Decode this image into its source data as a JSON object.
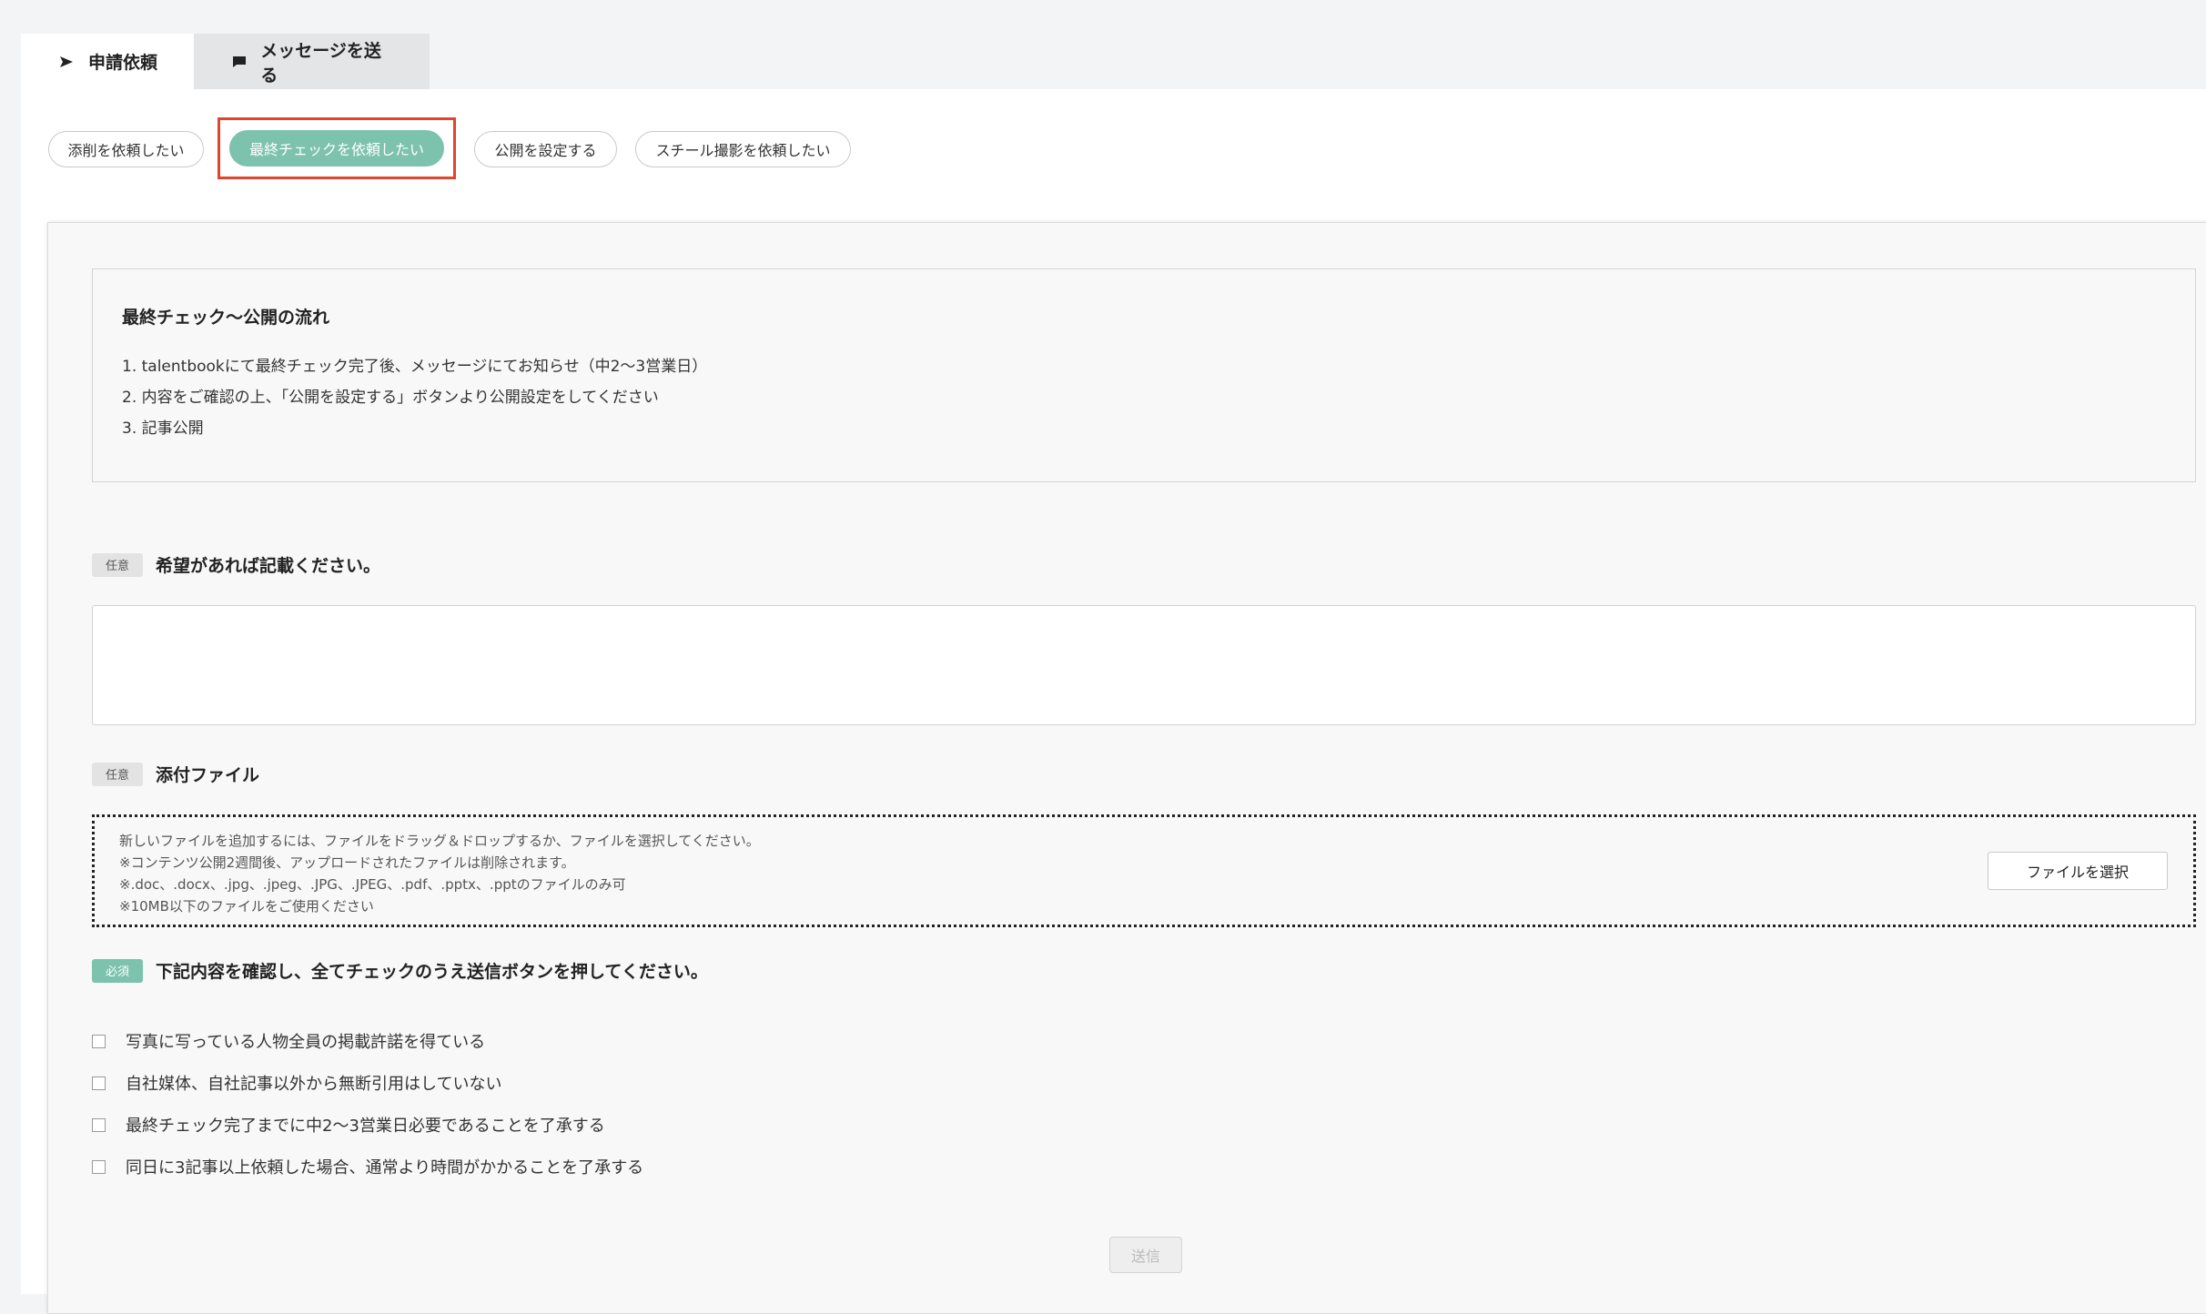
{
  "tabs": [
    {
      "label": "申請依頼",
      "icon": "send-icon"
    },
    {
      "label": "メッセージを送る",
      "icon": "message-icon"
    }
  ],
  "request_types": [
    {
      "label": "添削を依頼したい"
    },
    {
      "label": "最終チェックを依頼したい",
      "selected": true
    },
    {
      "label": "公開を設定する"
    },
    {
      "label": "スチール撮影を依頼したい"
    }
  ],
  "info": {
    "title": "最終チェック〜公開の流れ",
    "steps": [
      "1. talentbookにて最終チェック完了後、メッセージにてお知らせ（中2〜3営業日）",
      "2. 内容をご確認の上、「公開を設定する」ボタンより公開設定をしてください",
      "3. 記事公開"
    ]
  },
  "request_field": {
    "badge": "任意",
    "label": "希望があれば記載ください。",
    "value": ""
  },
  "attachment": {
    "badge": "任意",
    "label": "添付ファイル",
    "notes": [
      "新しいファイルを追加するには、ファイルをドラッグ＆ドロップするか、ファイルを選択してください。",
      "※コンテンツ公開2週間後、アップロードされたファイルは削除されます。",
      "※.doc、.docx、.jpg、.jpeg、.JPG、.JPEG、.pdf、.pptx、.pptのファイルのみ可",
      "※10MB以下のファイルをご使用ください"
    ],
    "button": "ファイルを選択"
  },
  "confirm": {
    "badge": "必須",
    "label": "下記内容を確認し、全てチェックのうえ送信ボタンを押してください。",
    "items": [
      {
        "label": "写真に写っている人物全員の掲載許諾を得ている",
        "checked": false
      },
      {
        "label": "自社媒体、自社記事以外から無断引用はしていない",
        "checked": false
      },
      {
        "label": "最終チェック完了までに中2〜3営業日必要であることを了承する",
        "checked": false
      },
      {
        "label": "同日に3記事以上依頼した場合、通常より時間がかかることを了承する",
        "checked": false
      }
    ]
  },
  "submit_label": "送信",
  "colors": {
    "accent": "#7cc2ad",
    "highlight": "#e0452e"
  }
}
